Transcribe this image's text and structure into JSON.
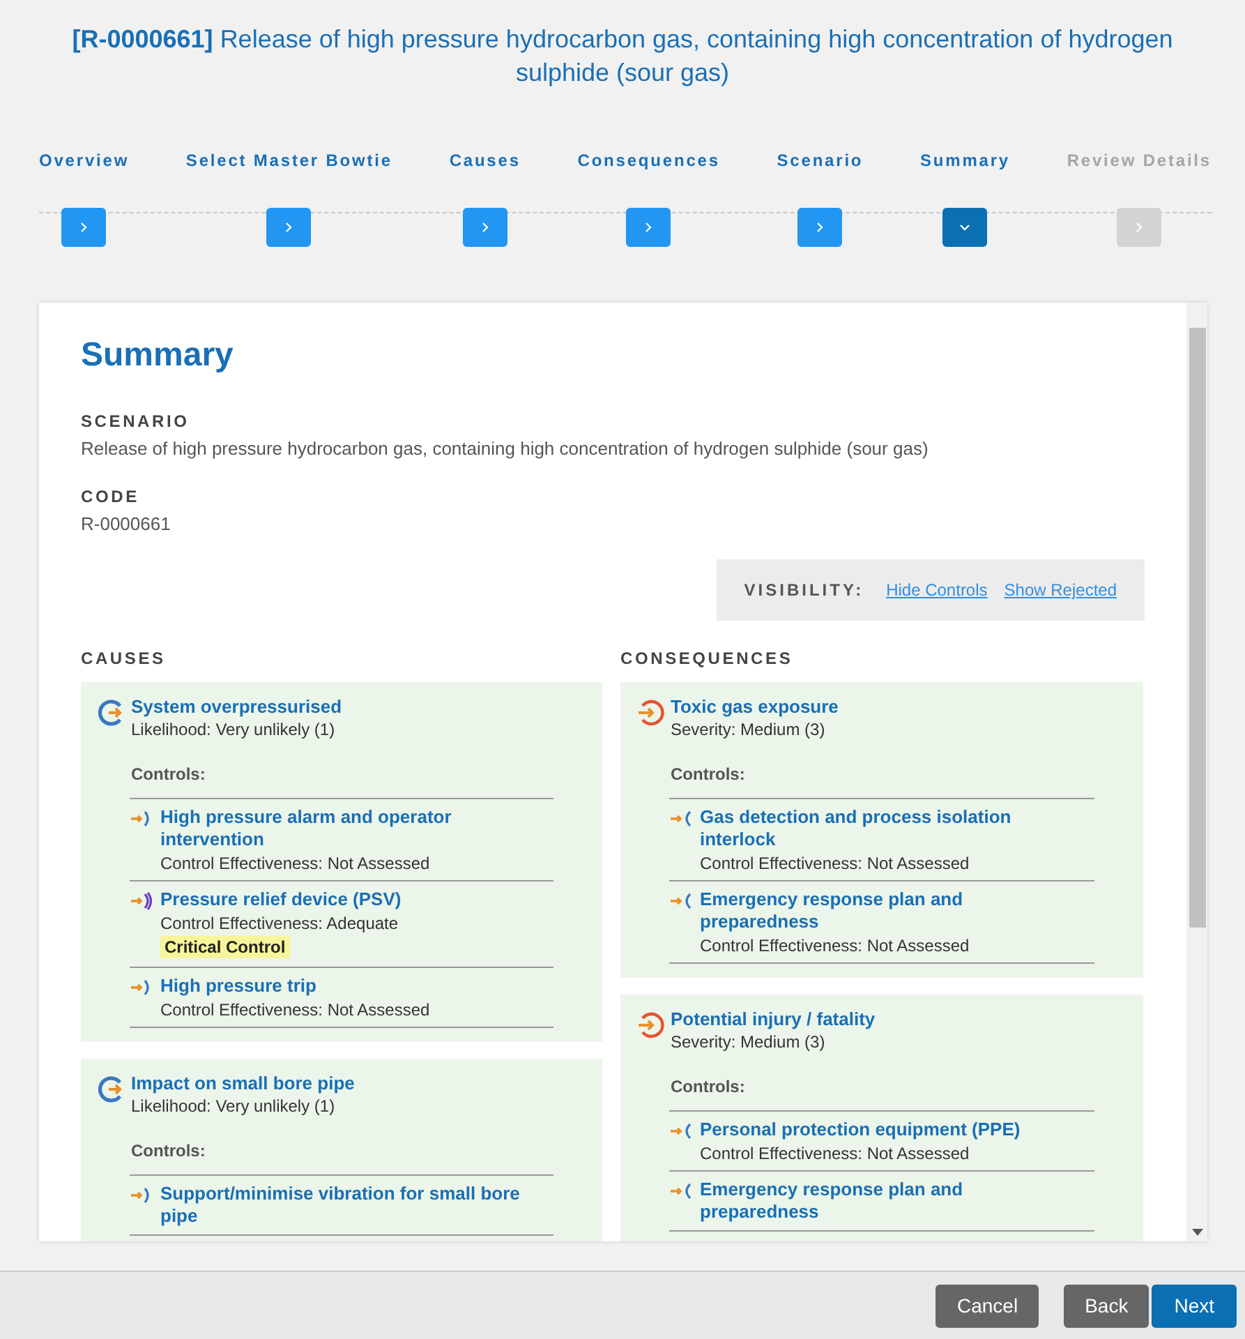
{
  "title": {
    "code": "[R-0000661]",
    "text": "Release of high pressure hydrocarbon gas, containing high concentration of hydrogen sulphide (sour gas)"
  },
  "steps": [
    {
      "label": "Overview",
      "selected": false,
      "disabled": false
    },
    {
      "label": "Select Master Bowtie",
      "selected": false,
      "disabled": false
    },
    {
      "label": "Causes",
      "selected": false,
      "disabled": false
    },
    {
      "label": "Consequences",
      "selected": false,
      "disabled": false
    },
    {
      "label": "Scenario",
      "selected": false,
      "disabled": false
    },
    {
      "label": "Summary",
      "selected": true,
      "disabled": false
    },
    {
      "label": "Review Details",
      "selected": false,
      "disabled": true
    }
  ],
  "summary": {
    "heading": "Summary",
    "fields": [
      {
        "label": "SCENARIO",
        "value": "Release of high pressure hydrocarbon gas, containing high concentration of hydrogen sulphide (sour gas)"
      },
      {
        "label": "CODE",
        "value": "R-0000661"
      }
    ],
    "visibility": {
      "label": "VISIBILITY:",
      "links": [
        "Hide Controls",
        "Show Rejected"
      ]
    },
    "columns": [
      {
        "heading": "CAUSES",
        "kind": "cause",
        "items": [
          {
            "title": "System overpressurised",
            "rating": "Likelihood: Very unlikely (1)",
            "controls_label": "Controls:",
            "controls": [
              {
                "name": "High pressure alarm and operator intervention",
                "effectiveness": "Control Effectiveness: Not Assessed",
                "critical": false
              },
              {
                "name": "Pressure relief device (PSV)",
                "effectiveness": "Control Effectiveness: Adequate",
                "critical": true,
                "critical_label": "Critical Control"
              },
              {
                "name": "High pressure trip",
                "effectiveness": "Control Effectiveness: Not Assessed",
                "critical": false
              }
            ]
          },
          {
            "title": "Impact on small bore pipe",
            "rating": "Likelihood: Very unlikely (1)",
            "controls_label": "Controls:",
            "controls": [
              {
                "name": "Support/minimise vibration for small bore pipe",
                "critical": false
              }
            ]
          }
        ]
      },
      {
        "heading": "CONSEQUENCES",
        "kind": "consequence",
        "items": [
          {
            "title": "Toxic gas exposure",
            "rating": "Severity: Medium (3)",
            "controls_label": "Controls:",
            "controls": [
              {
                "name": "Gas detection and process isolation interlock",
                "effectiveness": "Control Effectiveness: Not Assessed",
                "critical": false
              },
              {
                "name": "Emergency response plan and preparedness",
                "effectiveness": "Control Effectiveness: Not Assessed",
                "critical": false
              }
            ]
          },
          {
            "title": "Potential injury / fatality",
            "rating": "Severity: Medium (3)",
            "controls_label": "Controls:",
            "controls": [
              {
                "name": "Personal protection equipment (PPE)",
                "effectiveness": "Control Effectiveness: Not Assessed",
                "critical": false
              },
              {
                "name": "Emergency response plan and preparedness",
                "critical": false
              }
            ]
          }
        ]
      }
    ]
  },
  "buttons": [
    {
      "label": "Cancel",
      "kind": "secondary"
    },
    {
      "label": "Back",
      "kind": "secondary"
    },
    {
      "label": "Next",
      "kind": "primary"
    }
  ]
}
